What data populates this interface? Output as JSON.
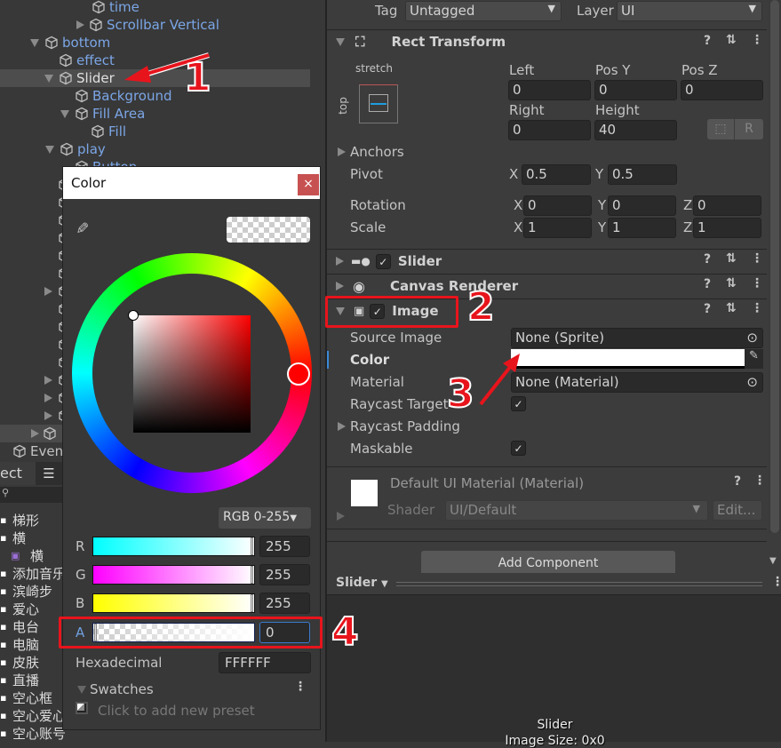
{
  "hierarchy": {
    "items": [
      {
        "label": "time"
      },
      {
        "label": "Scrollbar Vertical"
      },
      {
        "label": "bottom"
      },
      {
        "label": "effect"
      },
      {
        "label": "Slider"
      },
      {
        "label": "Background"
      },
      {
        "label": "Fill Area"
      },
      {
        "label": "Fill"
      },
      {
        "label": "play"
      },
      {
        "label": "Button"
      }
    ],
    "event_label": "Even"
  },
  "project": {
    "tab_label": "ect",
    "assets": [
      "梯形",
      "横",
      "横",
      "添加音乐",
      "滨崎步",
      "爱心",
      "电台",
      "电脑",
      "皮肤",
      "直播",
      "空心框",
      "空心爱心",
      "空心账号"
    ]
  },
  "inspector": {
    "tag_label": "Tag",
    "tag_value": "Untagged",
    "layer_label": "Layer",
    "layer_value": "UI",
    "rect_transform": {
      "title": "Rect Transform",
      "anchor_h": "stretch",
      "anchor_v": "top",
      "left_label": "Left",
      "left": "0",
      "posy_label": "Pos Y",
      "posy": "0",
      "posz_label": "Pos Z",
      "posz": "0",
      "right_label": "Right",
      "right": "0",
      "height_label": "Height",
      "height": "40",
      "r_button": "R",
      "anchors": "Anchors",
      "pivot": "Pivot",
      "pivot_x": "0.5",
      "pivot_y": "0.5",
      "rotation": "Rotation",
      "rot_x": "0",
      "rot_y": "0",
      "rot_z": "0",
      "scale": "Scale",
      "scale_x": "1",
      "scale_y": "1",
      "scale_z": "1",
      "x": "X",
      "y": "Y",
      "z": "Z"
    },
    "components": {
      "slider": "Slider",
      "canvas_renderer": "Canvas Renderer",
      "image": "Image"
    },
    "image": {
      "source_image_label": "Source Image",
      "source_image": "None (Sprite)",
      "color_label": "Color",
      "color_value": "#FFFFFF",
      "material_label": "Material",
      "material": "None (Material)",
      "raycast_target": "Raycast Target",
      "raycast_padding": "Raycast Padding",
      "maskable": "Maskable"
    },
    "material": {
      "name": "Default UI Material (Material)",
      "shader_label": "Shader",
      "shader": "UI/Default",
      "edit": "Edit..."
    },
    "add_component": "Add Component"
  },
  "preview": {
    "dropdown": "Slider",
    "name": "Slider",
    "size": "Image Size: 0x0"
  },
  "color_picker": {
    "title": "Color",
    "close": "×",
    "mode": "RGB 0-255",
    "r_label": "R",
    "r": "255",
    "g_label": "G",
    "g": "255",
    "b_label": "B",
    "b": "255",
    "a_label": "A",
    "a": "0",
    "hex_label": "Hexadecimal",
    "hex": "FFFFFF",
    "swatches": "Swatches",
    "add_preset": "Click to add new preset"
  },
  "annotations": [
    "1",
    "2",
    "3",
    "4"
  ],
  "colors": {
    "accent_red": "#e8141c",
    "hier_blue": "#7ba6e6",
    "close_red": "#c75050"
  }
}
